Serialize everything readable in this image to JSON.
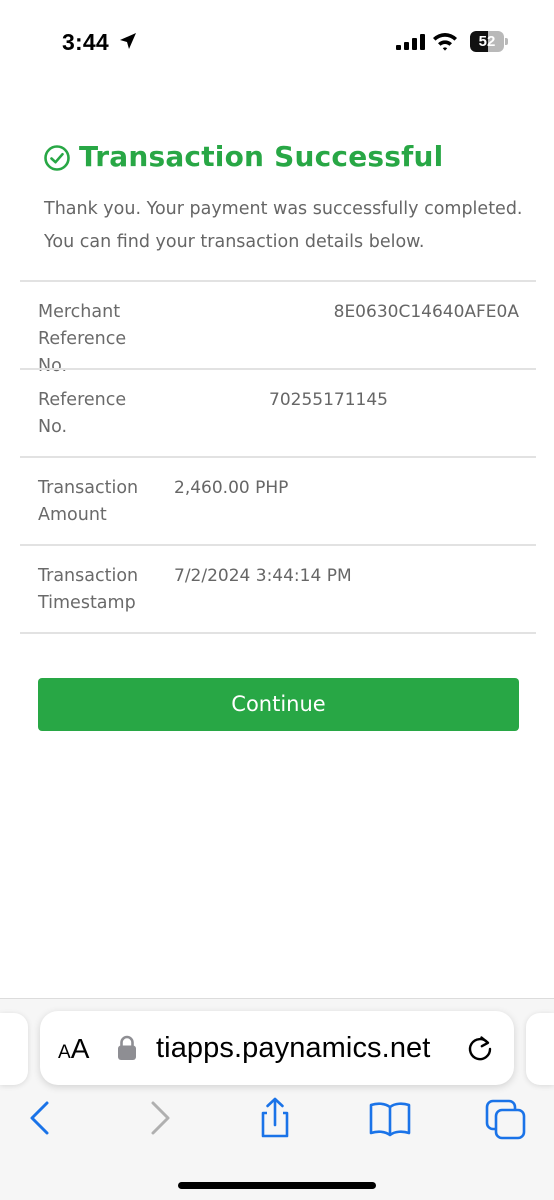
{
  "status_bar": {
    "time": "3:44",
    "battery_level": "52",
    "battery_fraction": 0.52
  },
  "page": {
    "title": "Transaction Successful",
    "message_line1": "Thank you. Your payment was successfully completed.",
    "message_line2": "You can find your transaction details below.",
    "details": [
      {
        "label_lines": [
          "Merchant",
          "Reference",
          "No."
        ],
        "value": "8E0630C14640AFE0A"
      },
      {
        "label_lines": [
          "Reference",
          "No."
        ],
        "value": "70255171145"
      },
      {
        "label_lines": [
          "Transaction",
          "Amount"
        ],
        "value": "2,460.00 PHP"
      },
      {
        "label_lines": [
          "Transaction",
          "Timestamp"
        ],
        "value": "7/2/2024 3:44:14 PM"
      }
    ],
    "continue_label": "Continue",
    "accent_color": "#28a745"
  },
  "browser": {
    "aa_label_small": "A",
    "aa_label_large": "A",
    "url": "tiapps.paynamics.net",
    "icons": [
      "lock-icon",
      "reload-icon",
      "back-icon",
      "forward-icon",
      "share-icon",
      "bookmarks-icon",
      "tabs-icon"
    ]
  }
}
